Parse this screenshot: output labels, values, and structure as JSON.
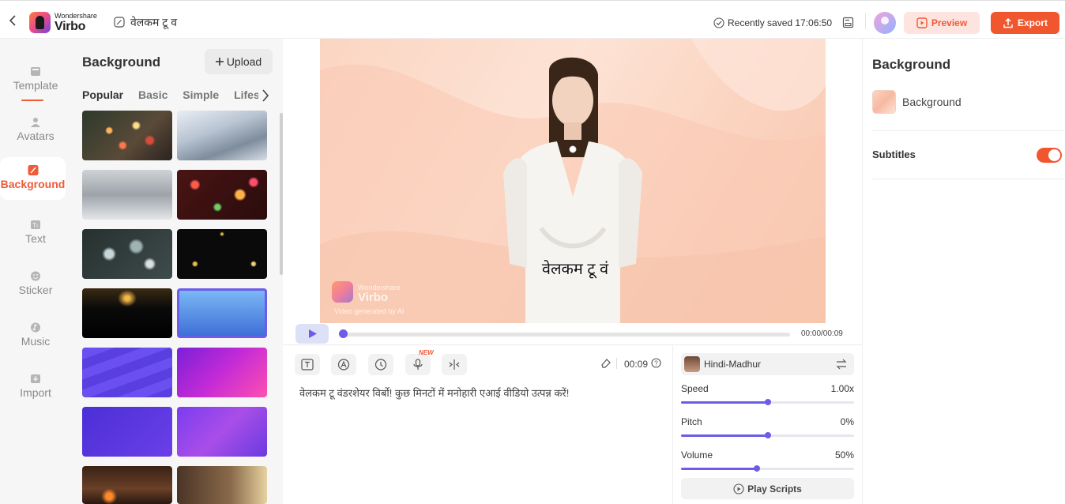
{
  "topbar": {
    "logo_brand": "Wondershare",
    "logo_name": "Virbo",
    "project_title": "वेलकम टू व",
    "saved_status": "Recently saved 17:06:50",
    "preview_label": "Preview",
    "export_label": "Export"
  },
  "nav": {
    "items": [
      {
        "label": "Template"
      },
      {
        "label": "Avatars"
      },
      {
        "label": "Background"
      },
      {
        "label": "Text"
      },
      {
        "label": "Sticker"
      },
      {
        "label": "Music"
      },
      {
        "label": "Import"
      }
    ],
    "active": "Background"
  },
  "panel": {
    "title": "Background",
    "upload_label": "Upload",
    "tabs": [
      "Popular",
      "Basic",
      "Simple",
      "Lifestyle"
    ],
    "active_tab": "Popular"
  },
  "canvas": {
    "subtitle": "वेलकम टू वं",
    "watermark_brand": "Wondershare",
    "watermark_name": "Virbo",
    "watermark_note": "Video generated by AI"
  },
  "player": {
    "time": "00:00/00:09",
    "progress": 0
  },
  "script": {
    "new_badge": "NEW",
    "duration": "00:09",
    "text": "वेलकम टू वंडरशेयर विर्बो! कुछ मिनटों में मनोहारी एआई वीडियो उत्पन्न करें!"
  },
  "voice": {
    "name": "Hindi-Madhur",
    "speed_label": "Speed",
    "speed_value": "1.00x",
    "speed_level": 0.5,
    "pitch_label": "Pitch",
    "pitch_value": "0%",
    "pitch_level": 0.5,
    "volume_label": "Volume",
    "volume_value": "50%",
    "volume_level": 0.44,
    "play_scripts_label": "Play Scripts"
  },
  "right": {
    "title": "Background",
    "background_label": "Background",
    "subtitles_label": "Subtitles",
    "subtitles_on": true
  },
  "colors": {
    "accent": "#f0572f",
    "purple": "#6c5ce7"
  }
}
